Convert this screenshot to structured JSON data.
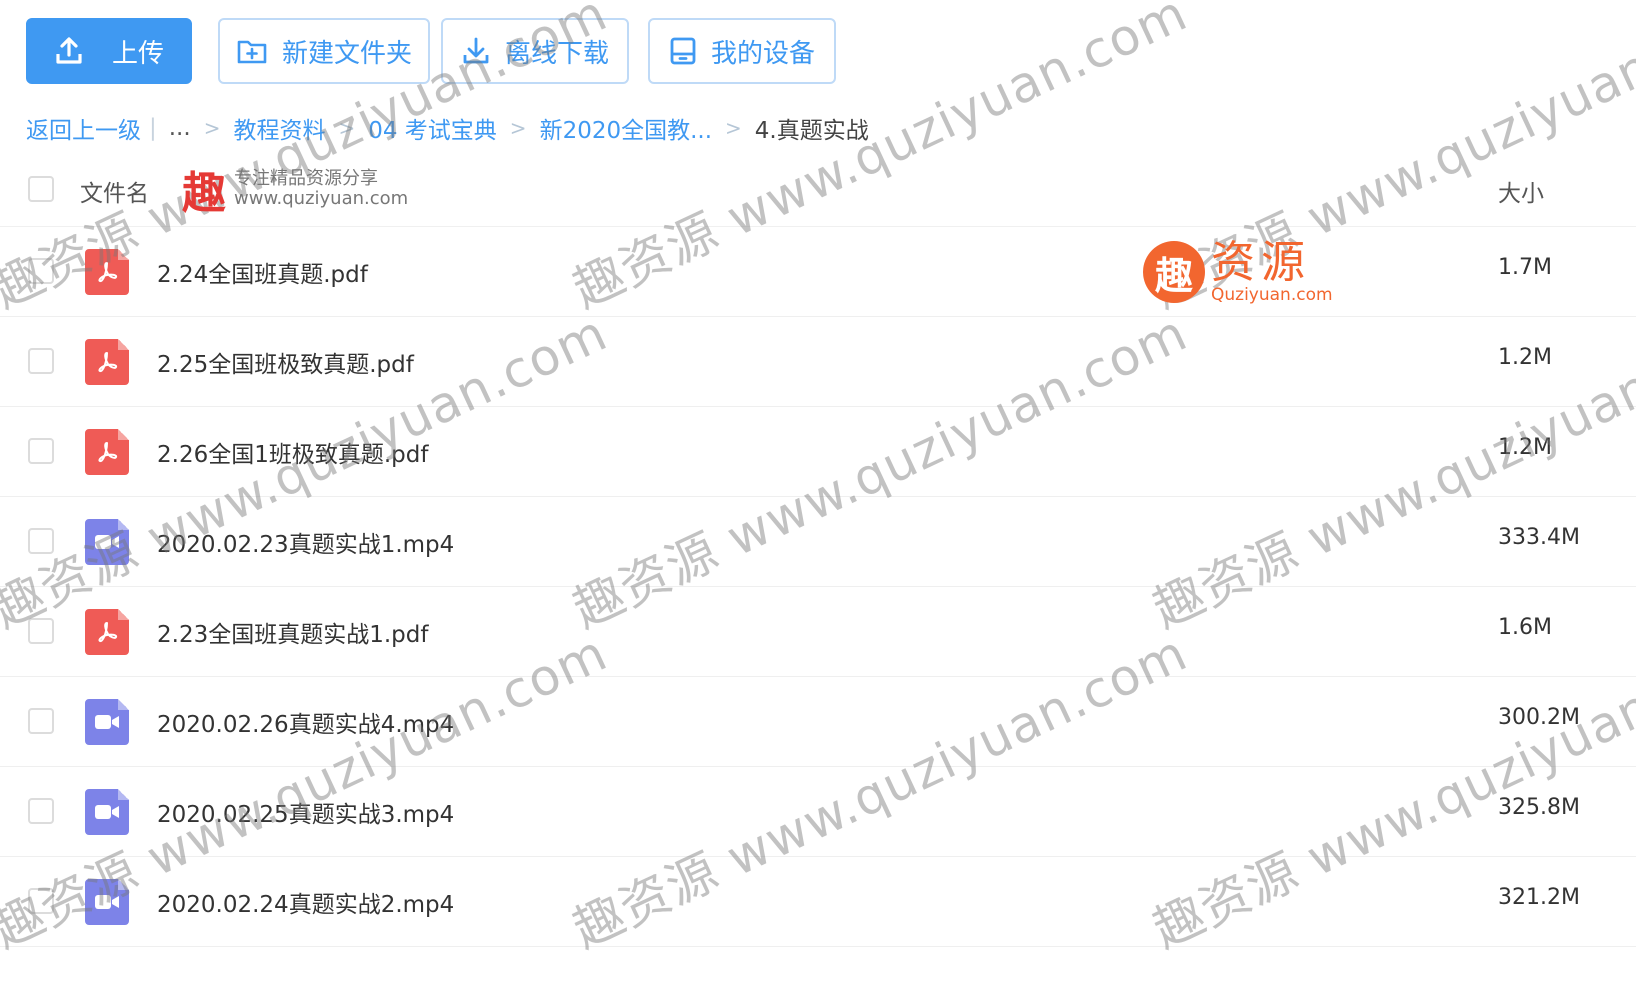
{
  "toolbar": {
    "upload_label": "上传",
    "new_folder_label": "新建文件夹",
    "offline_download_label": "离线下载",
    "my_devices_label": "我的设备"
  },
  "breadcrumb": {
    "back_label": "返回上一级",
    "ellipsis": "...",
    "items": [
      "教程资料",
      "04 考试宝典",
      "新2020全国教..."
    ],
    "current": "4.真题实战"
  },
  "list": {
    "header_name": "文件名",
    "header_size": "大小",
    "rows": [
      {
        "name": "2.24全国班真题.pdf",
        "size": "1.7M",
        "type": "pdf-icon"
      },
      {
        "name": "2.25全国班极致真题.pdf",
        "size": "1.2M",
        "type": "pdf-icon"
      },
      {
        "name": "2.26全国1班极致真题.pdf",
        "size": "1.2M",
        "type": "pdf-icon"
      },
      {
        "name": "2020.02.23真题实战1.mp4",
        "size": "333.4M",
        "type": "video-icon"
      },
      {
        "name": "2.23全国班真题实战1.pdf",
        "size": "1.6M",
        "type": "pdf-icon"
      },
      {
        "name": "2020.02.26真题实战4.mp4",
        "size": "300.2M",
        "type": "video-icon"
      },
      {
        "name": "2020.02.25真题实战3.mp4",
        "size": "325.8M",
        "type": "video-icon"
      },
      {
        "name": "2020.02.24真题实战2.mp4",
        "size": "321.2M",
        "type": "video-icon"
      }
    ]
  },
  "watermark": {
    "text": "趣资源 www.quziyuan.com",
    "stamp_big": "趣",
    "stamp_line1": "专注精品资源分享",
    "stamp_line2": "www.quziyuan.com",
    "badge_char": "趣",
    "badge_cn": "资源",
    "badge_en": "Quziyuan.com"
  },
  "colors": {
    "accent": "#3f99f2",
    "pdf": "#ef5b56",
    "video": "#7d83e8"
  }
}
